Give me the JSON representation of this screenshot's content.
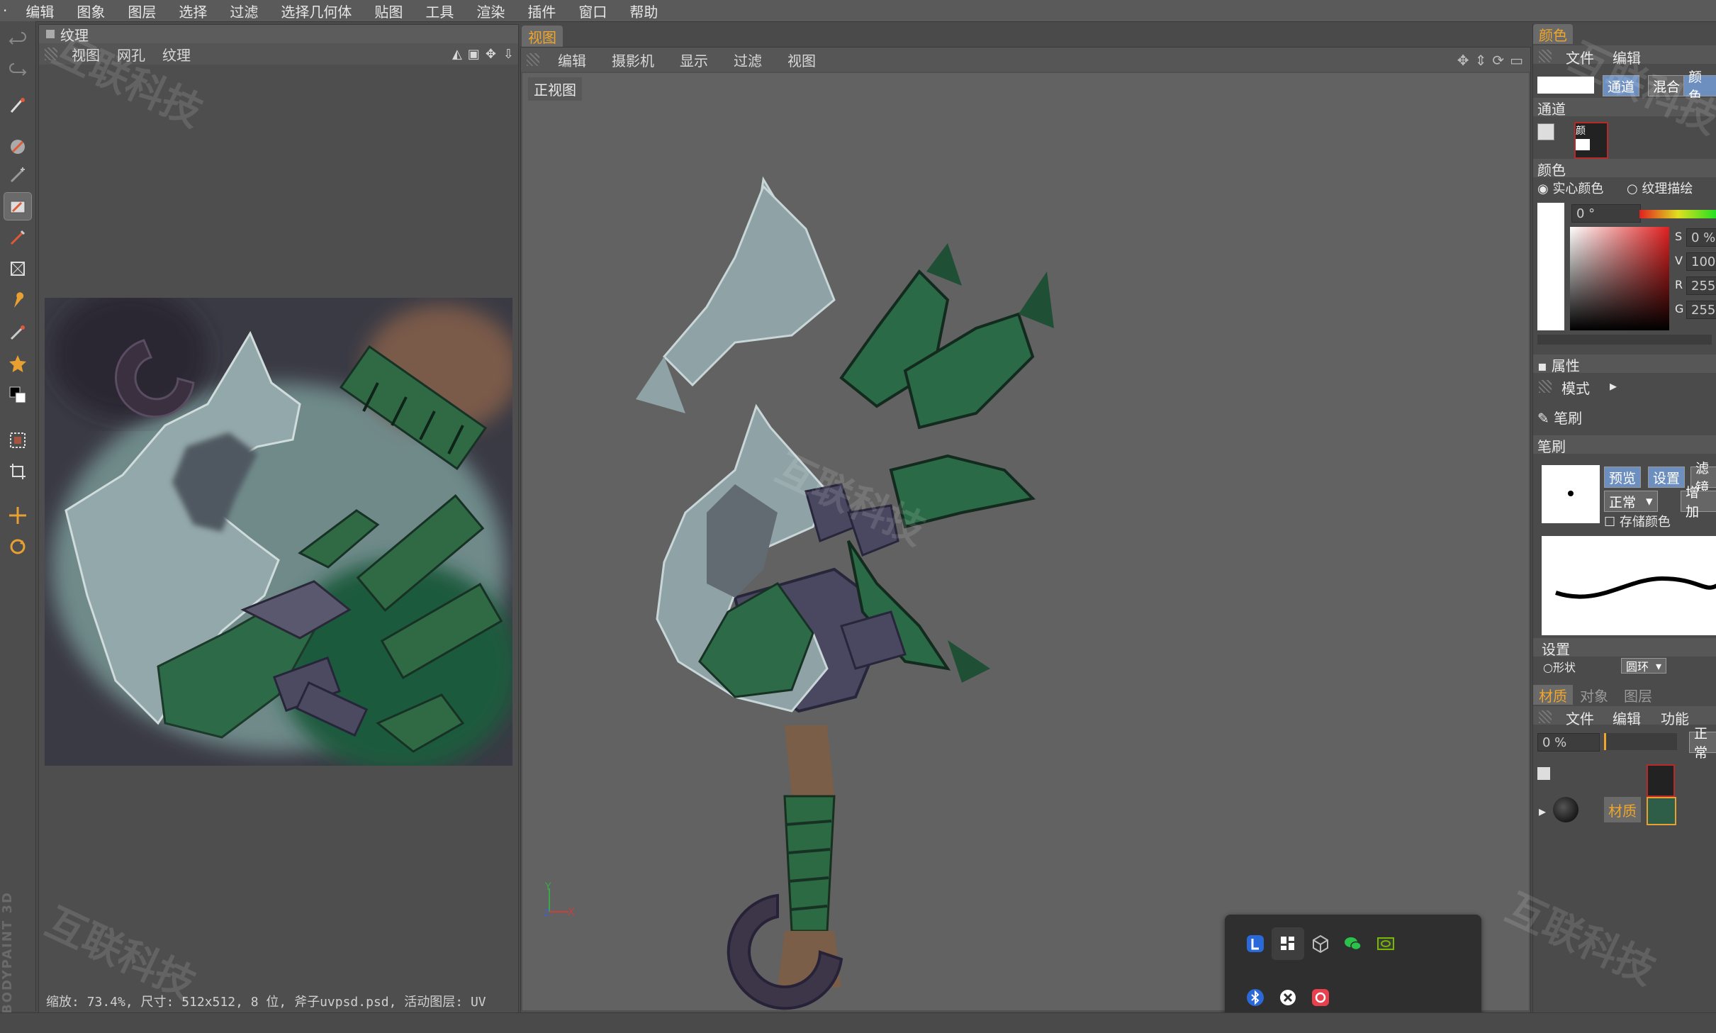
{
  "menubar": {
    "items": [
      "编辑",
      "图象",
      "图层",
      "选择",
      "过滤",
      "选择几何体",
      "贴图",
      "工具",
      "渲染",
      "插件",
      "窗口",
      "帮助"
    ]
  },
  "texture_panel": {
    "title": "纹理",
    "menu": [
      "视图",
      "网孔",
      "纹理"
    ],
    "status": "缩放: 73.4%, 尺寸: 512x512, 8 位, 斧子uvpsd.psd, 活动图层: UV"
  },
  "viewport": {
    "tab": "视图",
    "menu": [
      "编辑",
      "摄影机",
      "显示",
      "过滤",
      "视图"
    ],
    "view_label": "正视图",
    "axis": {
      "y": "Y",
      "x": "X",
      "z": "Z"
    }
  },
  "brand": "BODYPAINT 3D",
  "watermark": "互联科技",
  "right_panel": {
    "color_tab": "颜色",
    "menu": [
      "文件",
      "编辑"
    ],
    "mode_tabs": [
      "通道",
      "混合",
      "颜色"
    ],
    "channel_label": "通道",
    "channel_badge": "颜",
    "color_label": "颜色",
    "radio_solid": "实心颜色",
    "radio_texture": "纹理描绘",
    "hue_value": "0 °",
    "hsv": [
      {
        "key": "S",
        "val": "0 %"
      },
      {
        "key": "V",
        "val": "100"
      },
      {
        "key": "R",
        "val": "255"
      },
      {
        "key": "G",
        "val": "255"
      }
    ],
    "attr_label": "属性",
    "mode_label": "模式",
    "brush_tool": "笔刷",
    "brush_section": "笔刷",
    "brush_tabs": [
      "预览",
      "设置",
      "滤镜"
    ],
    "brush_mode": "正常",
    "brush_add": "增加",
    "store_color": "存储颜色",
    "settings_label": "设置",
    "shape_label": "形状",
    "shape_value": "圆环",
    "bottom_tabs": [
      "材质",
      "对象",
      "图层"
    ],
    "bottom_menu": [
      "文件",
      "编辑",
      "功能"
    ],
    "opacity": "0 %",
    "blend": "正常",
    "material_name": "材质",
    "accent": "#f0a62a"
  }
}
